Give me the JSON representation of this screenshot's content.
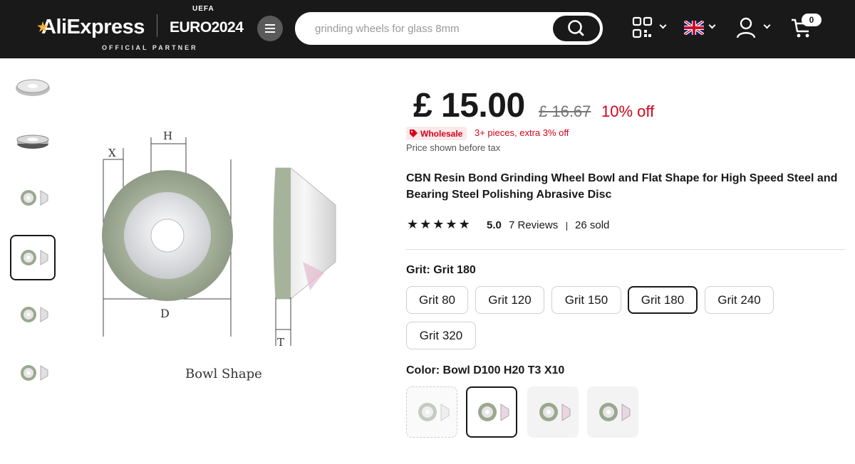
{
  "header": {
    "logo_text": "AliExpress",
    "euro_text": "EURO2024",
    "uefa_text": "UEFA",
    "partner_text": "OFFICIAL PARTNER",
    "search_placeholder": "grinding wheels for glass 8mm",
    "cart_count": "0",
    "icons": [
      "menu-icon",
      "search-icon",
      "qr-code-icon",
      "uk-flag-icon",
      "user-icon",
      "cart-icon"
    ]
  },
  "gallery": {
    "thumbnails": [
      "thumb-1",
      "thumb-2",
      "thumb-3",
      "thumb-4",
      "thumb-5",
      "thumb-6"
    ],
    "active_index": 3,
    "main_image_labels": {
      "x": "X",
      "h": "H",
      "d": "D",
      "t": "T",
      "caption": "Bowl Shape"
    }
  },
  "product": {
    "price": "£ 15.00",
    "original_price": "£ 16.67",
    "discount": "10% off",
    "wholesale_tag": "Wholesale",
    "wholesale_text": "3+ pieces, extra 3% off",
    "tax_note": "Price shown before tax",
    "title": "CBN Resin Bond Grinding Wheel Bowl and Flat Shape for High Speed Steel and Bearing Steel Polishing Abrasive Disc",
    "rating": "5.0",
    "rating_value": 5.0,
    "reviews": "7 Reviews",
    "sold": "26 sold"
  },
  "options": {
    "grit_label": "Grit: Grit 180",
    "grits": [
      "Grit 80",
      "Grit 120",
      "Grit 150",
      "Grit 180",
      "Grit 240",
      "Grit 320"
    ],
    "selected_grit": "Grit 180",
    "color_label": "Color: Bowl D100 H20 T3 X10",
    "colors_count_shown": 4,
    "selected_color_index": 1
  },
  "colors": {
    "accent_red": "#d3031c",
    "header_bg": "#191919"
  }
}
